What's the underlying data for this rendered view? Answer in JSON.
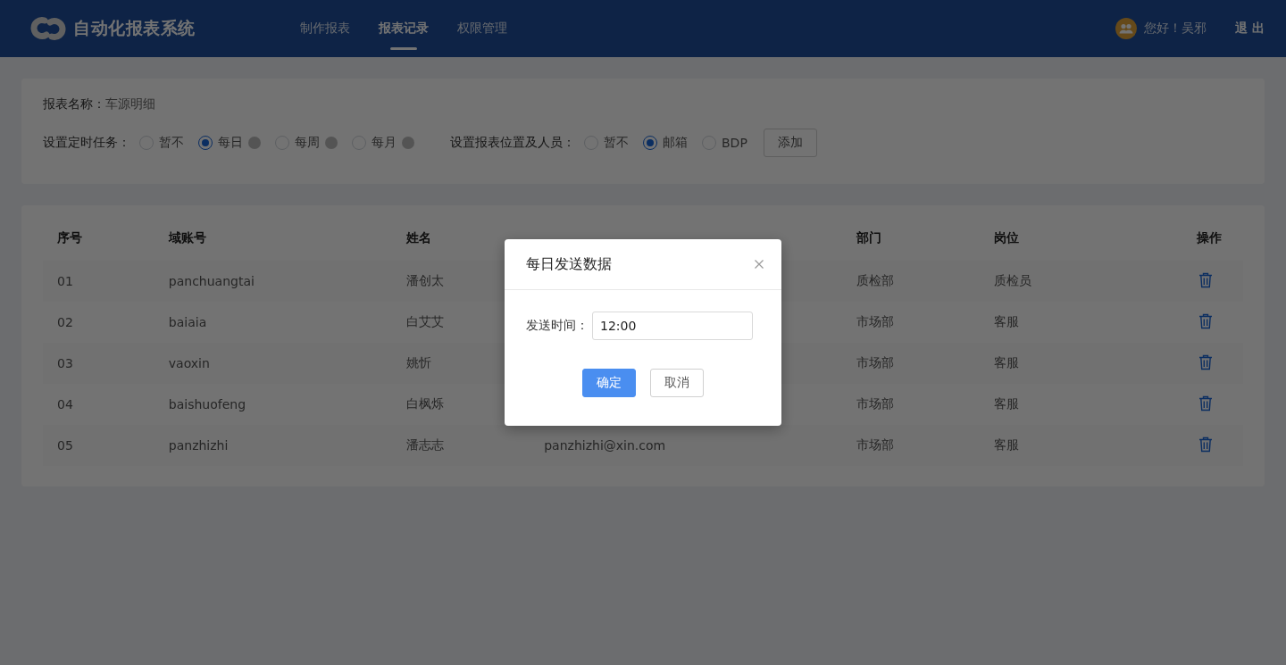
{
  "header": {
    "app_title": "自动化报表系统",
    "nav": [
      {
        "label": "制作报表",
        "selected": false
      },
      {
        "label": "报表记录",
        "selected": true
      },
      {
        "label": "权限管理",
        "selected": false
      }
    ],
    "greeting": "您好！吴邪",
    "logout": "退 出"
  },
  "settings": {
    "report_name_label": "报表名称：",
    "report_name": "车源明细",
    "schedule_label": "设置定时任务：",
    "schedule_options": [
      {
        "label": "暂不",
        "selected": false,
        "help": false
      },
      {
        "label": "每日",
        "selected": true,
        "help": true
      },
      {
        "label": "每周",
        "selected": false,
        "help": true
      },
      {
        "label": "每月",
        "selected": false,
        "help": true
      }
    ],
    "target_label": "设置报表位置及人员：",
    "target_options": [
      {
        "label": "暂不",
        "selected": false
      },
      {
        "label": "邮箱",
        "selected": true
      },
      {
        "label": "BDP",
        "selected": false
      }
    ],
    "add_button": "添加"
  },
  "table": {
    "columns": [
      "序号",
      "域账号",
      "姓名",
      "部门",
      "岗位",
      "操作"
    ],
    "rows": [
      {
        "no": "01",
        "account": "panchuangtai",
        "name": "潘创太",
        "department": "质检部",
        "position": "质检员"
      },
      {
        "no": "02",
        "account": "baiaia",
        "name": "白艾艾",
        "department": "市场部",
        "position": "客服"
      },
      {
        "no": "03",
        "account": "vaoxin",
        "name": "姚忻",
        "department": "市场部",
        "position": "客服"
      },
      {
        "no": "04",
        "account": "baishuofeng",
        "name": "白枫烁",
        "department": "市场部",
        "position": "客服"
      },
      {
        "no": "05",
        "account": "panzhizhi",
        "name": "潘志志",
        "email": "panzhizhi@xin.com",
        "department": "市场部",
        "position": "客服"
      }
    ]
  },
  "dialog": {
    "title": "每日发送数据",
    "field_label": "发送时间：",
    "field_value": "12:00",
    "ok": "确定",
    "cancel": "取消"
  }
}
